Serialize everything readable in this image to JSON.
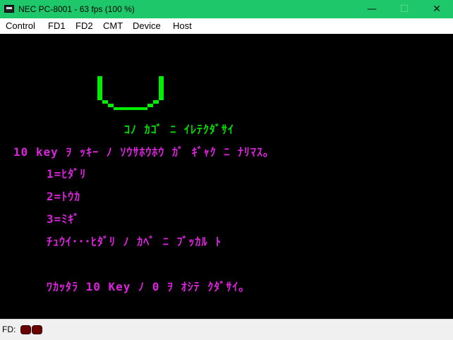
{
  "window": {
    "title": "NEC PC-8001 - 63 fps (100 %)",
    "minimize_glyph": "—",
    "maximize_glyph": "☐",
    "close_glyph": "✕",
    "title_bar_color": "#1ec86a"
  },
  "menu": {
    "items": [
      "Control",
      "FD1",
      "FD2",
      "CMT",
      "Device",
      "Host"
    ]
  },
  "screen": {
    "colors": {
      "title": "#00dd00",
      "text": "#dd22dd",
      "cup": "#00ee00"
    },
    "lines": [
      "ｺﾉ ｶｺﾞ ﾆ ｲﾚﾃｸﾀﾞｻｲ",
      "10 key ｦ ｯｷｰ ﾉ ｿｳｻﾎｳﾎｳ ｶﾞ ｷﾞｬｸ ﾆ ﾅﾘﾏｽ｡",
      "1=ﾋﾀﾞﾘ",
      "2=ﾄｳｶ",
      "3=ﾐｷﾞ",
      "ﾁｭｳｲ･･･ﾋﾀﾞﾘ ﾉ ｶﾍﾞ ﾆ ﾌﾞｯｶﾙ ﾄ",
      "ﾜｶｯﾀﾗ 10 Key ﾉ 0 ｦ ｵｼﾃ ｸﾀﾞｻｲ｡"
    ]
  },
  "status": {
    "fd_label": "FD:",
    "led_color": "#6b0000"
  }
}
